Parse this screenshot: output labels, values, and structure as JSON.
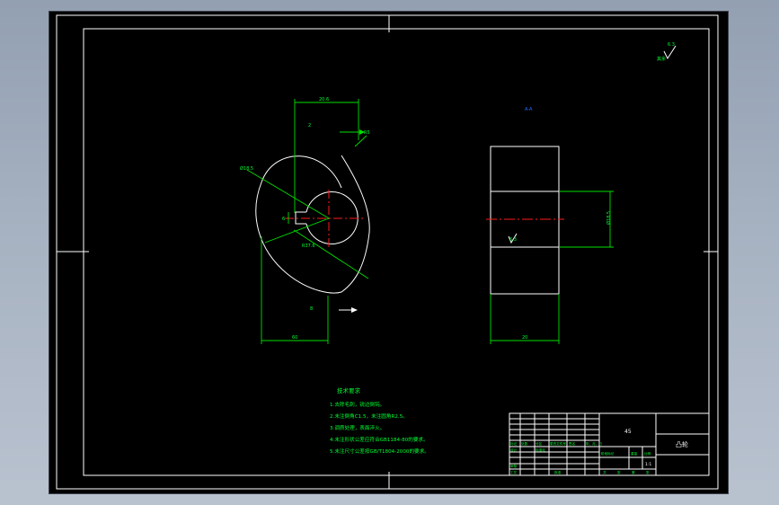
{
  "drawing": {
    "front_view": {
      "dim_top": "20.6",
      "dim_left_inner": "2",
      "dim_radius": "R5",
      "dim_bore": "Ø18.5",
      "dim_key_slot": "6",
      "dim_lower_radius": "R37.6",
      "dim_bottom_small": "8",
      "dim_bottom": "60"
    },
    "side_view": {
      "view_label": "A-A",
      "dim_right": "Ø18.5",
      "dim_bottom": "20",
      "surface_roughness": "6.3"
    },
    "roughness_note": {
      "symbol": "6.3",
      "text": "其余"
    },
    "tech_requirements": {
      "title": "技术要求",
      "items": [
        "1.去除毛刺，锐边倒钝。",
        "2.未注倒角C1.5，未注圆角R2.5。",
        "3.调质处理，表面淬火。",
        "4.未注形状公差应符合GB1184-80的要求。",
        "5.未注尺寸公差按GB/T1804-2000的要求。"
      ]
    },
    "title_block": {
      "material": "45",
      "part_name": "凸轮",
      "scale": "1:1",
      "labels": [
        "标记",
        "处数",
        "分区",
        "更改文件号",
        "签名",
        "年、月、日"
      ],
      "labels2": [
        "设计",
        "标准化",
        "审核",
        "工艺",
        "批准"
      ],
      "stage_labels": [
        "阶段标记",
        "重量",
        "比例"
      ],
      "sheet_labels": [
        "共",
        "张",
        "第",
        "张"
      ]
    }
  }
}
